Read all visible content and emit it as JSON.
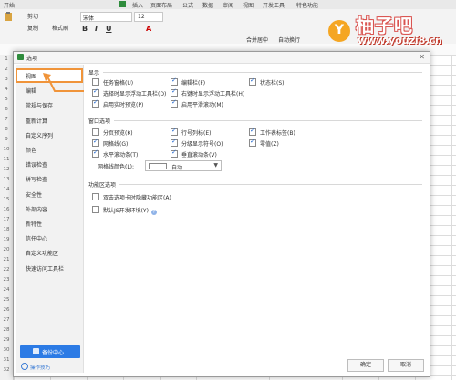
{
  "menubar": {
    "items": [
      "开始",
      "插入",
      "页面布局",
      "公式",
      "数据",
      "审阅",
      "视图",
      "开发工具",
      "特色功能"
    ]
  },
  "ribbon": {
    "cut": "剪切",
    "copy": "复制",
    "format_painter": "格式刷",
    "font_name": "宋体",
    "font_size": "12",
    "merge_center": "合并居中",
    "auto_wrap": "自动换行"
  },
  "watermark": {
    "logo_char": "Y",
    "title": "柚子吧",
    "url": "www.youzi8.cn"
  },
  "dialog": {
    "title": "选项",
    "sidebar": [
      {
        "label": "视图",
        "selected": true
      },
      {
        "label": "编辑",
        "selected": false
      },
      {
        "label": "常规与保存",
        "selected": false
      },
      {
        "label": "重新计算",
        "selected": false
      },
      {
        "label": "自定义序列",
        "selected": false
      },
      {
        "label": "颜色",
        "selected": false
      },
      {
        "label": "错误检查",
        "selected": false
      },
      {
        "label": "拼写检查",
        "selected": false
      },
      {
        "label": "安全性",
        "selected": false
      },
      {
        "label": "外部内容",
        "selected": false
      },
      {
        "label": "新特性",
        "selected": false
      },
      {
        "label": "信任中心",
        "selected": false
      },
      {
        "label": "自定义功能区",
        "selected": false
      },
      {
        "label": "快速访问工具栏",
        "selected": false
      }
    ],
    "backup_center": "备份中心",
    "tips": "操作技巧",
    "sections": {
      "display": "显示",
      "window": "窗口选项",
      "ribbon": "功能区选项"
    },
    "display_options": [
      {
        "label": "任务窗格(U)",
        "checked": false
      },
      {
        "label": "编辑栏(F)",
        "checked": true
      },
      {
        "label": "状态栏(S)",
        "checked": true
      },
      {
        "label": "选择时显示浮动工具栏(D)",
        "checked": true
      },
      {
        "label": "右键时显示浮动工具栏(H)",
        "checked": true
      },
      {
        "label": "启用实时预览(P)",
        "checked": true
      },
      {
        "label": "启用平滑滚动(M)",
        "checked": true
      }
    ],
    "window_options": [
      {
        "label": "分页预览(K)",
        "checked": false
      },
      {
        "label": "行号列标(E)",
        "checked": true
      },
      {
        "label": "工作表标签(B)",
        "checked": true
      },
      {
        "label": "网格线(G)",
        "checked": true
      },
      {
        "label": "分级显示符号(O)",
        "checked": true
      },
      {
        "label": "零值(Z)",
        "checked": true
      },
      {
        "label": "水平滚动条(T)",
        "checked": true
      },
      {
        "label": "垂直滚动条(V)",
        "checked": true
      }
    ],
    "gridline_color_label": "网格线颜色(L):",
    "gridline_color_value": "自动",
    "ribbon_options": [
      {
        "label": "双击选项卡时隐藏功能区(A)",
        "checked": false
      },
      {
        "label": "默认JS开发环境(Y)",
        "checked": false
      }
    ],
    "ok": "确定",
    "cancel": "取消"
  },
  "row_numbers": [
    "1",
    "2",
    "3",
    "4",
    "5",
    "6",
    "7",
    "8",
    "9",
    "10",
    "11",
    "12",
    "13",
    "14",
    "15",
    "16",
    "17",
    "18",
    "19",
    "20",
    "21",
    "22",
    "23",
    "24",
    "25",
    "26",
    "27",
    "28",
    "29",
    "30",
    "31",
    "32"
  ],
  "colors": {
    "accent": "#2f8c3d",
    "selected_outline": "#f0943a",
    "backup_blue": "#2c7be5"
  }
}
